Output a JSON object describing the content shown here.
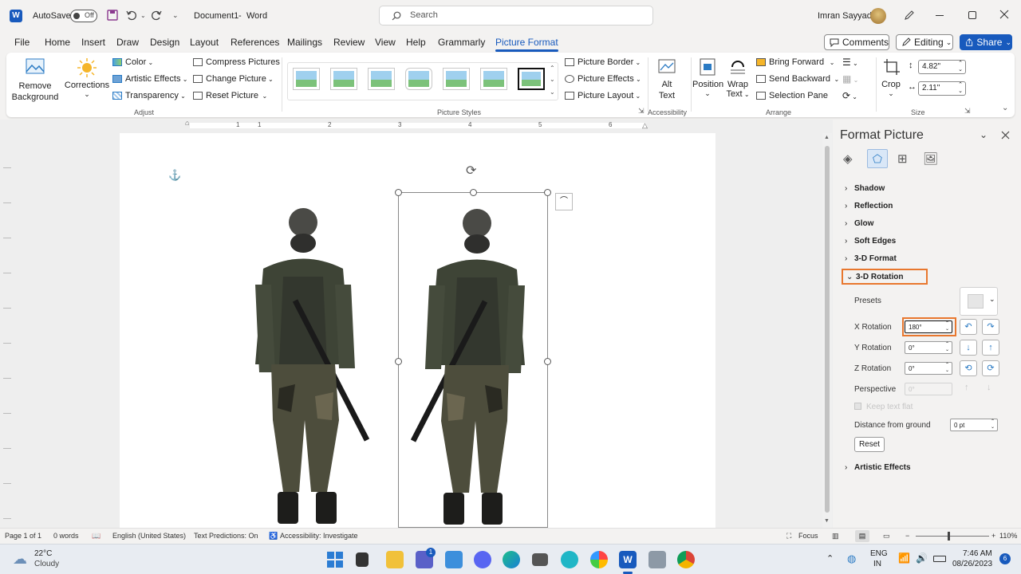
{
  "titlebar": {
    "autosave_label": "AutoSave",
    "autosave_state": "Off",
    "doc_name": "Document1",
    "separator": "-",
    "app_name": "Word",
    "search_placeholder": "Search",
    "user_name": "Imran Sayyad"
  },
  "tabs": [
    "File",
    "Home",
    "Insert",
    "Draw",
    "Design",
    "Layout",
    "References",
    "Mailings",
    "Review",
    "View",
    "Help",
    "Grammarly",
    "Picture Format"
  ],
  "active_tab": "Picture Format",
  "top_buttons": {
    "comments": "Comments",
    "editing": "Editing",
    "share": "Share"
  },
  "ribbon": {
    "remove_bg": [
      "Remove",
      "Background"
    ],
    "corrections": "Corrections",
    "color": "Color",
    "artistic": "Artistic Effects",
    "transparency": "Transparency",
    "compress": "Compress Pictures",
    "change": "Change Picture",
    "reset": "Reset Picture",
    "group_adjust": "Adjust",
    "group_styles": "Picture Styles",
    "border": "Picture Border",
    "effects": "Picture Effects",
    "layout": "Picture Layout",
    "alt": [
      "Alt",
      "Text"
    ],
    "group_access": "Accessibility",
    "position": "Position",
    "wrap": [
      "Wrap",
      "Text"
    ],
    "bring": "Bring Forward",
    "send": "Send Backward",
    "selection": "Selection Pane",
    "group_arrange": "Arrange",
    "crop": "Crop",
    "height": "4.82\"",
    "width": "2.11\"",
    "group_size": "Size"
  },
  "ruler_numbers": [
    "1",
    "1",
    "2",
    "3",
    "4",
    "5",
    "6"
  ],
  "pane": {
    "title": "Format Picture",
    "sections": [
      "Shadow",
      "Reflection",
      "Glow",
      "Soft Edges",
      "3-D Format"
    ],
    "open_section": "3-D Rotation",
    "presets": "Presets",
    "x_label": "X Rotation",
    "x_value": "180°",
    "y_label": "Y Rotation",
    "y_value": "0°",
    "z_label": "Z Rotation",
    "z_value": "0°",
    "perspective": "Perspective",
    "perspective_value": "0°",
    "keep_flat": "Keep text flat",
    "distance": "Distance from ground",
    "distance_value": "0 pt",
    "reset": "Reset",
    "artistic": "Artistic Effects"
  },
  "status": {
    "page": "Page 1 of 1",
    "words": "0 words",
    "language": "English (United States)",
    "predictions": "Text Predictions: On",
    "accessibility": "Accessibility: Investigate",
    "focus": "Focus",
    "zoom": "110%"
  },
  "taskbar": {
    "temp": "22°C",
    "weather": "Cloudy",
    "lang1": "ENG",
    "lang2": "IN",
    "time": "7:46 AM",
    "date": "08/26/2023",
    "badge": "1",
    "notif": "6"
  },
  "colors": {
    "accent": "#185abd",
    "highlight": "#e8772e"
  }
}
